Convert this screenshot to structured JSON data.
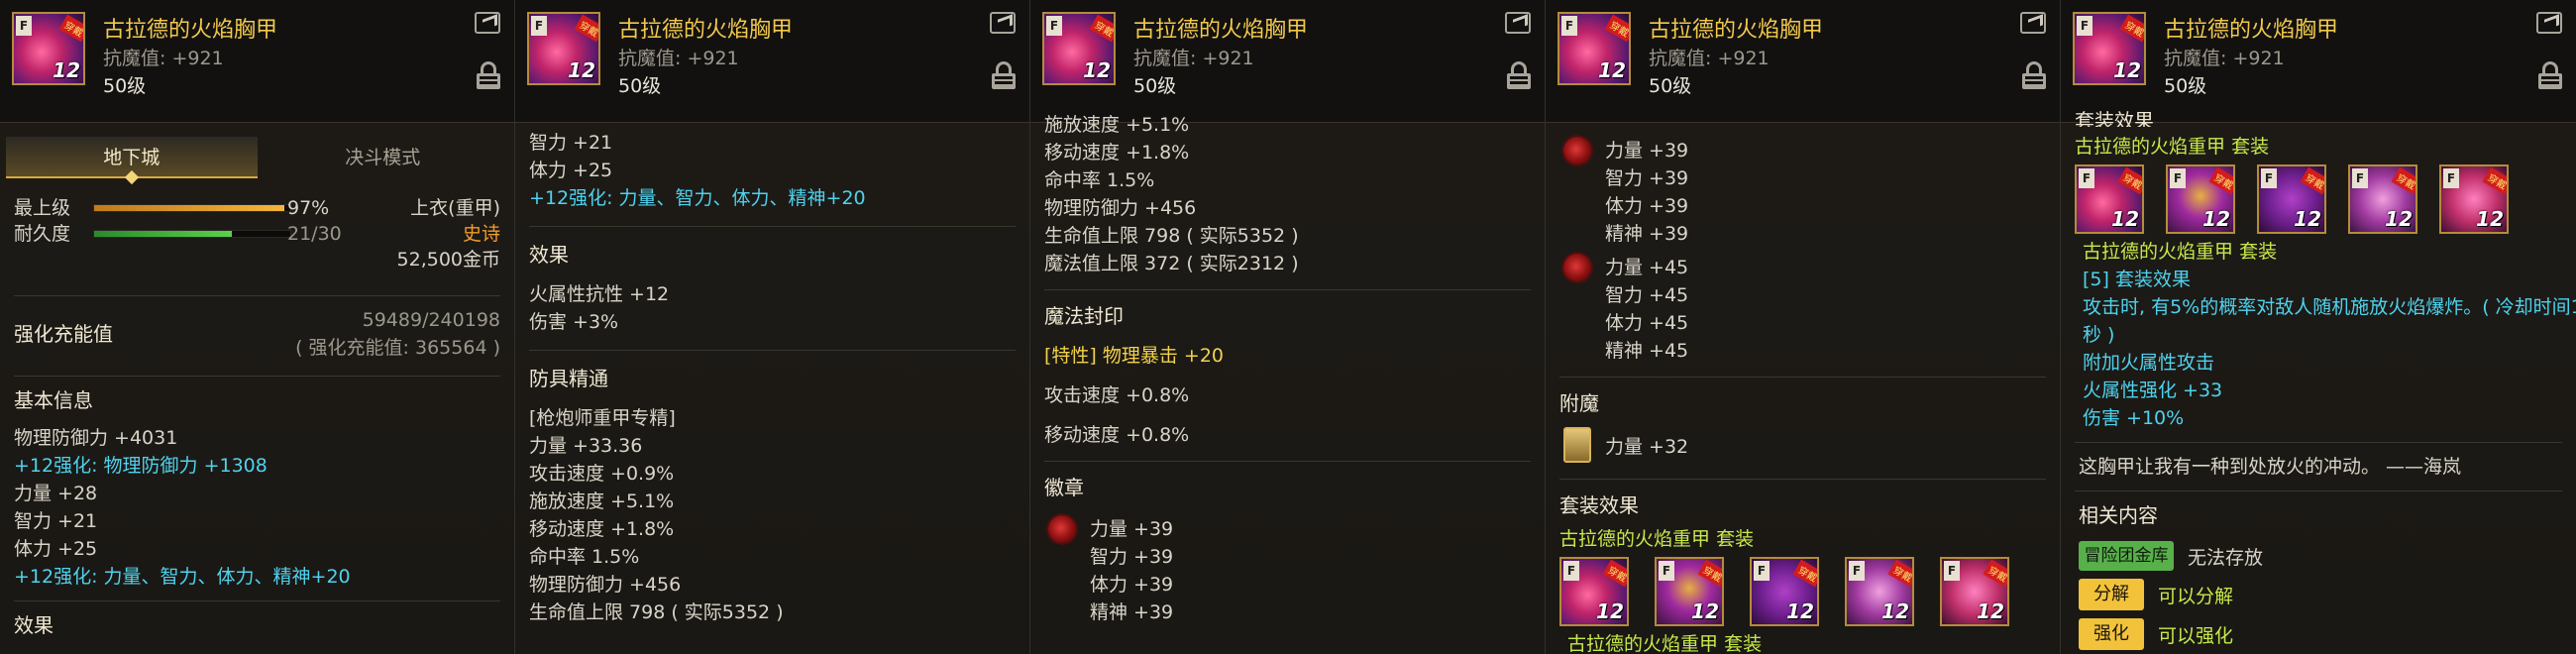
{
  "item": {
    "name": "古拉德的火焰胸甲",
    "magic_resist": "抗魔值: +921",
    "level": "50级",
    "enhance": "12",
    "tag": "F",
    "banner": "穿戴"
  },
  "p1": {
    "tabs": [
      "地下城",
      "决斗模式"
    ],
    "max_level_label": "最上级",
    "max_level_pct": "97%",
    "max_level_fill": 0.97,
    "durability_label": "耐久度",
    "durability_val": "21/30",
    "durability_fill": 0.7,
    "slot": "上衣(重甲)",
    "rarity": "史诗",
    "price": "52,500金币",
    "charge_label": "强化充能值",
    "charge_val": "59489/240198",
    "charge_note": "( 强化充能值: 365564 )",
    "basic_title": "基本信息",
    "lines": [
      {
        "t": "物理防御力 +4031",
        "c": ""
      },
      {
        "t": "+12强化: 物理防御力 +1308",
        "c": "cy"
      },
      {
        "t": "力量 +28",
        "c": ""
      },
      {
        "t": "智力 +21",
        "c": ""
      },
      {
        "t": "体力 +25",
        "c": ""
      },
      {
        "t": "+12强化: 力量、智力、体力、精神+20",
        "c": "cy"
      }
    ],
    "effect_title": "效果"
  },
  "p2": {
    "lines_top": [
      {
        "t": "智力 +21",
        "c": ""
      },
      {
        "t": "体力 +25",
        "c": ""
      },
      {
        "t": "+12强化: 力量、智力、体力、精神+20",
        "c": "cy"
      }
    ],
    "effect_title": "效果",
    "effects": [
      "火属性抗性 +12",
      "伤害 +3%"
    ],
    "mastery_title": "防具精通",
    "mastery": [
      "[枪炮师重甲专精]",
      "力量 +33.36",
      "攻击速度 +0.9%",
      "施放速度 +5.1%",
      "移动速度 +1.8%",
      "命中率 1.5%",
      "物理防御力 +456",
      "生命值上限 798 ( 实际5352 )"
    ]
  },
  "p3": {
    "lines_top": [
      "施放速度 +5.1%",
      "移动速度 +1.8%",
      "命中率 1.5%",
      "物理防御力 +456",
      "生命值上限 798 ( 实际5352 )",
      "魔法值上限 372 ( 实际2312 )"
    ],
    "seal_title": "魔法封印",
    "seal": [
      {
        "t": "[特性] 物理暴击 +20",
        "c": "yl"
      },
      {
        "t": "攻击速度 +0.8%",
        "c": ""
      },
      {
        "t": "移动速度 +0.8%",
        "c": ""
      }
    ],
    "emblem_title": "徽章",
    "emblem": [
      "力量 +39",
      "智力 +39",
      "体力 +39",
      "精神 +39"
    ]
  },
  "p4": {
    "emblem1": [
      "力量 +39",
      "智力 +39",
      "体力 +39",
      "精神 +39"
    ],
    "emblem2": [
      "力量 +45",
      "智力 +45",
      "体力 +45",
      "精神 +45"
    ],
    "enchant_title": "附魔",
    "enchant": "力量 +32",
    "set_title": "套装效果",
    "set_name": "古拉德的火焰重甲",
    "set_suffix": "套装",
    "set_name2": "古拉德的火焰重甲",
    "set_suffix2": "套装"
  },
  "p5": {
    "top_cut": "套装效果",
    "set_name": "古拉德的火焰重甲",
    "set_suffix": "套装",
    "set_line": "古拉德的火焰重甲",
    "set_line_suffix": "套装",
    "set5": "[5] 套装效果",
    "desc1": "攻击时, 有5%的概率对敌人随机施放火焰爆炸。( 冷却时间1",
    "desc2": "秒 )",
    "bonus": [
      "附加火属性攻击",
      "火属性强化 +33",
      "伤害 +10%"
    ],
    "quote": "这胸甲让我有一种到处放火的冲动。 ——海岚",
    "related_title": "相关内容",
    "guild_btn": "冒险团金库",
    "guild_val": "无法存放",
    "disassemble_btn": "分解",
    "disassemble_val": "可以分解",
    "enhance_btn": "强化",
    "enhance_val": "可以强化"
  }
}
